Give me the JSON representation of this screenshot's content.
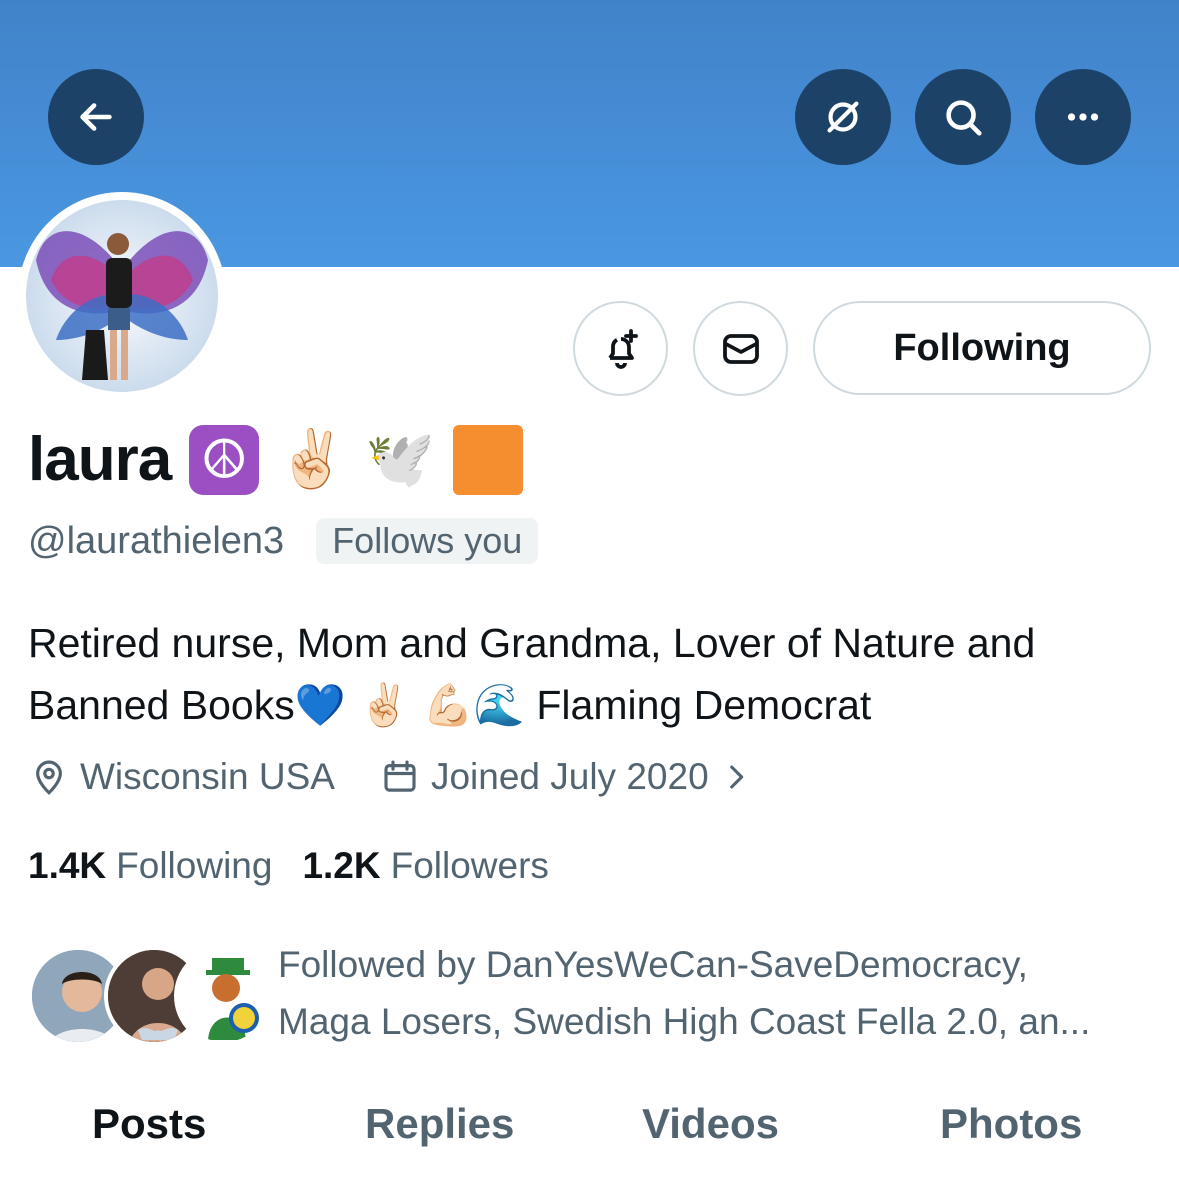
{
  "header": {
    "back_icon": "arrow-left-icon",
    "grok_icon": "slashed-circle-icon",
    "search_icon": "search-icon",
    "more_icon": "more-horizontal-icon"
  },
  "actions": {
    "notify_icon": "bell-plus-icon",
    "message_icon": "mail-icon",
    "following_label": "Following"
  },
  "profile": {
    "name": "laura",
    "name_emojis": [
      "☮️",
      "✌🏻",
      "🕊️"
    ],
    "handle": "@laurathielen3",
    "follows_you": "Follows you",
    "bio_line1": "Retired nurse, Mom and Grandma, Lover of Nature and",
    "bio_line2_text": "Banned Books",
    "bio_line2_emojis": "💙 ✌🏻 💪🏻🌊",
    "bio_line2_tail": "Flaming Democrat",
    "location": "Wisconsin USA",
    "joined": "Joined July 2020"
  },
  "stats": {
    "following_count": "1.4K",
    "following_label": "Following",
    "followers_count": "1.2K",
    "followers_label": "Followers"
  },
  "followed_by": {
    "line1": "Followed by DanYesWeCan-SaveDemocracy,",
    "line2": "Maga Losers, Swedish High Coast Fella 2.0, an..."
  },
  "tabs": [
    {
      "label": "Posts",
      "active": true
    },
    {
      "label": "Replies",
      "active": false
    },
    {
      "label": "Videos",
      "active": false
    },
    {
      "label": "Photos",
      "active": false
    }
  ],
  "colors": {
    "banner_top": "#4183c9",
    "banner_bottom": "#4a97e2",
    "header_button": "#1c4268",
    "secondary_text": "#536471",
    "peace_box": "#9b4fc3",
    "orange_box": "#f58e2f"
  }
}
